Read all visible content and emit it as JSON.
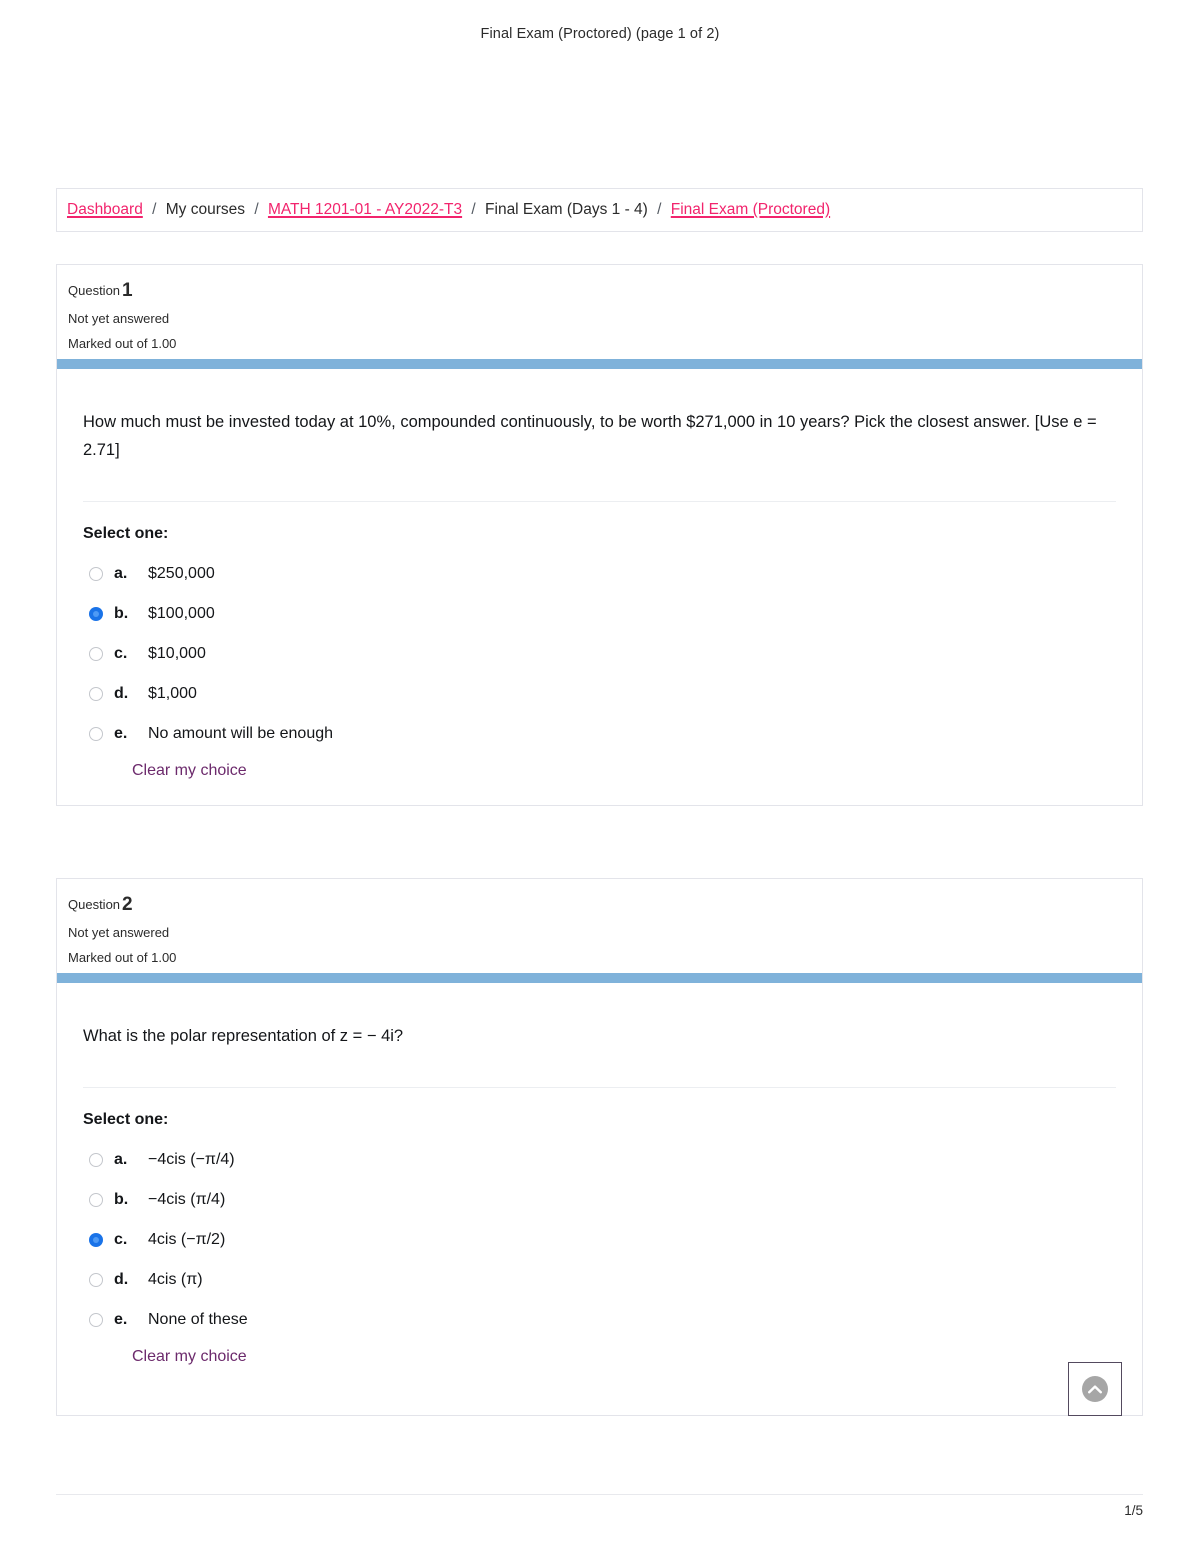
{
  "header": {
    "title": "Final Exam (Proctored) (page 1 of 2)"
  },
  "breadcrumb": {
    "separator": "/",
    "items": [
      {
        "label": "Dashboard",
        "link": true
      },
      {
        "label": "My courses",
        "link": false
      },
      {
        "label": "MATH 1201-01 - AY2022-T3",
        "link": true
      },
      {
        "label": "Final Exam (Days 1 - 4)",
        "link": false
      },
      {
        "label": "Final Exam (Proctored)",
        "link": true
      }
    ]
  },
  "questions": [
    {
      "number_label": "Question",
      "number": "1",
      "state": "Not yet answered",
      "marks": "Marked out of 1.00",
      "text": "How much must be invested today at 10%, compounded continuously, to be worth $271,000 in 10 years? Pick the closest answer. [Use e = 2.71]",
      "select_one_label": "Select one:",
      "options": [
        {
          "letter": "a.",
          "text": "$250,000",
          "selected": false
        },
        {
          "letter": "b.",
          "text": "$100,000",
          "selected": true
        },
        {
          "letter": "c.",
          "text": "$10,000",
          "selected": false
        },
        {
          "letter": "d.",
          "text": "$1,000",
          "selected": false
        },
        {
          "letter": "e.",
          "text": "No amount will be enough",
          "selected": false
        }
      ],
      "clear_label": "Clear my choice"
    },
    {
      "number_label": "Question",
      "number": "2",
      "state": "Not yet answered",
      "marks": "Marked out of 1.00",
      "text": "What is the polar representation of z = − 4i?",
      "select_one_label": "Select one:",
      "options": [
        {
          "letter": "a.",
          "text": "−4cis (−π/4)",
          "selected": false
        },
        {
          "letter": "b.",
          "text": "−4cis (π/4)",
          "selected": false
        },
        {
          "letter": "c.",
          "text": "4cis (−π/2)",
          "selected": true
        },
        {
          "letter": "d.",
          "text": "4cis (π)",
          "selected": false
        },
        {
          "letter": "e.",
          "text": "None of these",
          "selected": false
        }
      ],
      "clear_label": "Clear my choice"
    }
  ],
  "scroll_top": {
    "icon": "chevron-up-icon"
  },
  "footer": {
    "page": "1/5"
  },
  "colors": {
    "link": "#f2246d",
    "clear_link": "#6c2a6c",
    "question_bar": "#7fb2da",
    "radio_selected": "#1a73e8",
    "card_border": "#e3e4ea"
  }
}
